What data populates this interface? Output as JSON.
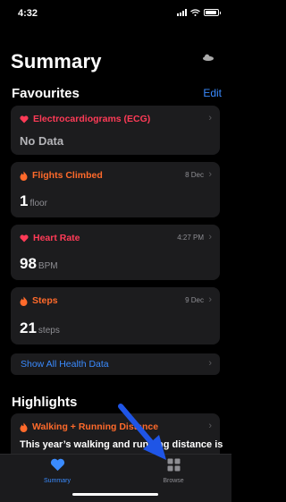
{
  "status": {
    "time": "4:32"
  },
  "page": {
    "title": "Summary"
  },
  "favourites": {
    "heading": "Favourites",
    "edit_label": "Edit",
    "cards": [
      {
        "title": "Electrocardiograms (ECG)",
        "value": "No Data",
        "date": "",
        "icon": "heart-icon",
        "color": "#ff3b57"
      },
      {
        "title": "Flights Climbed",
        "value": "1",
        "unit": "floor",
        "date": "8 Dec",
        "icon": "flame-icon",
        "color": "#ff6a2b"
      },
      {
        "title": "Heart Rate",
        "value": "98",
        "unit": "BPM",
        "date": "4:27 PM",
        "icon": "heart-icon",
        "color": "#ff3b57"
      },
      {
        "title": "Steps",
        "value": "21",
        "unit": "steps",
        "date": "9 Dec",
        "icon": "flame-icon",
        "color": "#ff6a2b"
      }
    ],
    "show_all": "Show All Health Data"
  },
  "highlights": {
    "heading": "Highlights",
    "card_title": "Walking + Running Distance",
    "card_text": "This year’s walking and running distance is"
  },
  "tabbar": {
    "summary_label": "Summary",
    "browse_label": "Browse",
    "accent": "#3a8bff",
    "inactive": "#8e8e93"
  }
}
